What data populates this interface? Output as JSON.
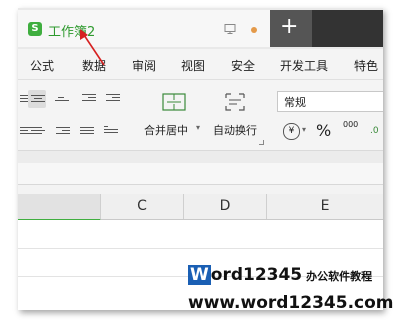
{
  "tab": {
    "icon_letter": "S",
    "title": "工作簿2"
  },
  "menu": [
    "公式",
    "数据",
    "审阅",
    "视图",
    "安全",
    "开发工具",
    "特色"
  ],
  "ribbon": {
    "merge_label": "合并居中",
    "wrap_label": "自动换行",
    "number_format": "常规",
    "currency_symbol": "¥",
    "percent_symbol": "%",
    "thousands_symbol": "000"
  },
  "columns": [
    "C",
    "D",
    "E"
  ],
  "watermark": {
    "brand_first": "W",
    "brand_rest": "ord12345",
    "tagline": "办公软件教程",
    "url": "www.word12345.com"
  },
  "colors": {
    "title_green": "#2e9a2e",
    "arrow_red": "#d62020",
    "brand_blue": "#1a5fb4"
  }
}
